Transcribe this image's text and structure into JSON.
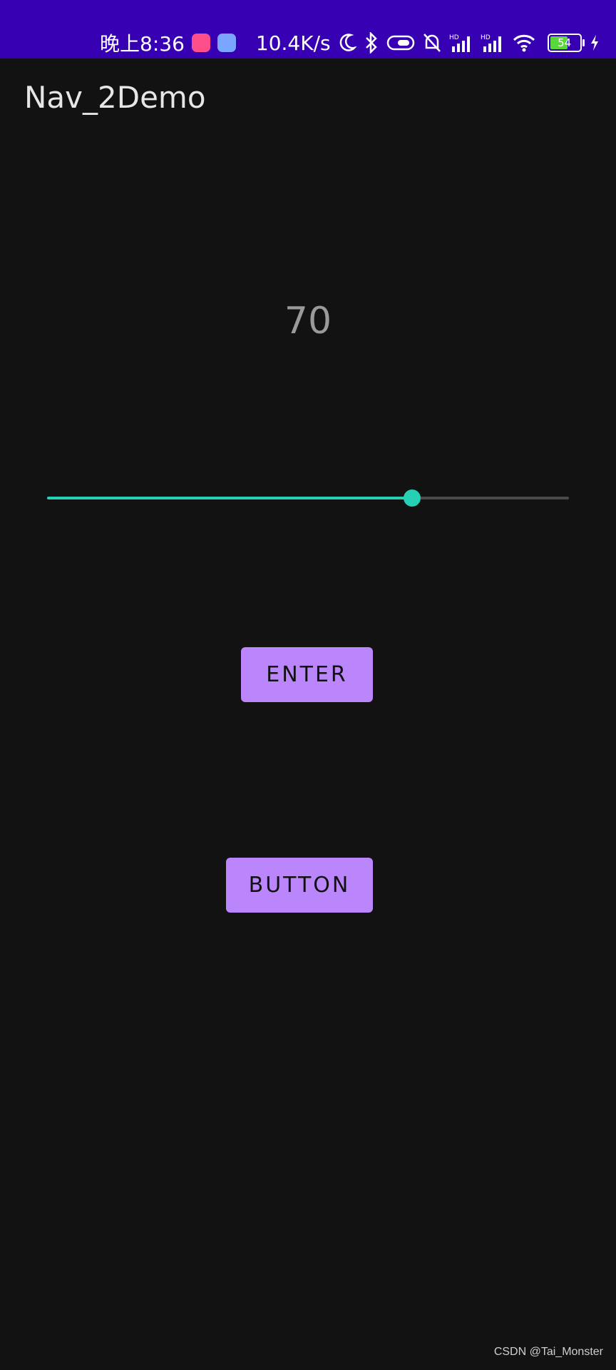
{
  "status_bar": {
    "time": "晚上8:36",
    "net_speed": "10.4K/s",
    "battery_level": "54",
    "icons": [
      "bilibili-app-icon",
      "app-icon",
      "moon-icon",
      "bluetooth-icon",
      "toggle-icon",
      "bell-mute-icon",
      "signal-hd-icon",
      "signal-hd-icon",
      "wifi-icon",
      "battery-icon",
      "charging-icon"
    ],
    "background": "#3700b3"
  },
  "app_bar": {
    "title": "Nav_2Demo"
  },
  "main": {
    "value": "70",
    "slider": {
      "value": 70,
      "min": 0,
      "max": 100,
      "active_color": "#26d0b4",
      "inactive_color": "#4a4a4a"
    },
    "enter_label": "ENTER",
    "button_label": "BUTTON",
    "button_color": "#bb86fc"
  },
  "watermark": "CSDN @Tai_Monster"
}
